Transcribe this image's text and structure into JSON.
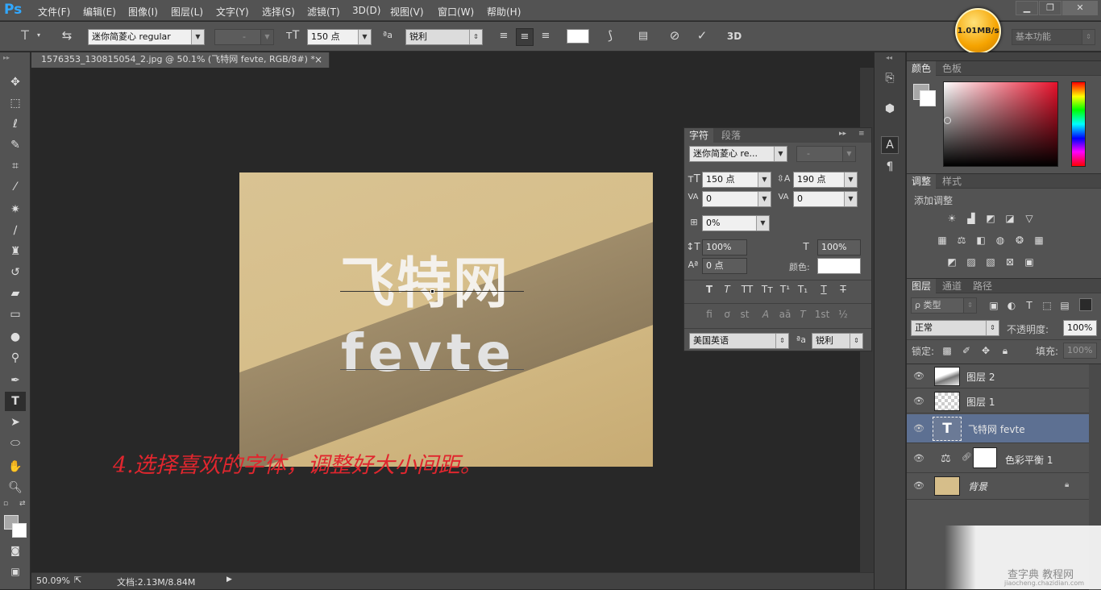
{
  "app": {
    "logo": "Ps"
  },
  "menu": [
    "文件(F)",
    "编辑(E)",
    "图像(I)",
    "图层(L)",
    "文字(Y)",
    "选择(S)",
    "滤镜(T)",
    "3D(D)",
    "视图(V)",
    "窗口(W)",
    "帮助(H)"
  ],
  "window_controls": {
    "minimize": "▁",
    "restore": "❐",
    "close": "✕"
  },
  "options": {
    "font_family": "迷你简菱心 regular",
    "font_style": "-",
    "font_size": "150 点",
    "aa_label": "ªa",
    "antialias": "锐利",
    "workspace": "基本功能",
    "threed": "3D"
  },
  "speed_badge": "1.01MB/s",
  "document": {
    "tab_title": "1576353_130815054_2.jpg @ 50.1% (飞特网 fevte, RGB/8#) *",
    "tab_close": "×",
    "text_line1": "飞特网",
    "text_line2": "fevte",
    "note": "4.选择喜欢的字体，调整好大小间距。"
  },
  "status": {
    "zoom": "50.09%",
    "doc_info": "文档:2.13M/8.84M"
  },
  "character_panel": {
    "tab_char": "字符",
    "tab_para": "段落",
    "font_family": "迷你简菱心 re...",
    "font_style": "-",
    "size": "150 点",
    "leading": "190 点",
    "kerning": "0",
    "tracking": "0",
    "tsume": "0%",
    "vscale": "100%",
    "hscale": "100%",
    "baseline": "0 点",
    "color_label": "颜色:",
    "language": "美国英语",
    "aa_label": "ªa",
    "antialias": "锐利",
    "style_buttons": [
      "T",
      "T",
      "TT",
      "Tт",
      "T¹",
      "T₁",
      "T",
      "T"
    ],
    "ot_buttons": [
      "fi",
      "ơ",
      "st",
      "A",
      "aā",
      "T",
      "1st",
      "½"
    ]
  },
  "color_panel": {
    "tab_color": "颜色",
    "tab_swatches": "色板"
  },
  "adjust_panel": {
    "tab_adjust": "调整",
    "tab_styles": "样式",
    "add_label": "添加调整"
  },
  "layers_panel": {
    "tab_layers": "图层",
    "tab_channels": "通道",
    "tab_paths": "路径",
    "filter_kind": "ρ 类型",
    "blend_mode": "正常",
    "opacity_label": "不透明度:",
    "opacity": "100%",
    "lock_label": "锁定:",
    "fill_label": "填充:",
    "fill": "100%",
    "layers": [
      {
        "name": "图层 2"
      },
      {
        "name": "图层 1"
      },
      {
        "name": "飞特网 fevte"
      },
      {
        "name": "色彩平衡 1"
      },
      {
        "name": "背景"
      }
    ]
  },
  "watermark": {
    "line1": "查字典 教程网",
    "line2": "jiaocheng.chazidian.com"
  }
}
